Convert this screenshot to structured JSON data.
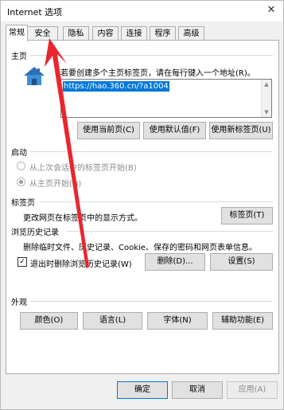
{
  "window": {
    "title": "Internet 选项",
    "close_glyph": "✕"
  },
  "tabs": [
    "常规",
    "安全",
    "隐私",
    "内容",
    "连接",
    "程序",
    "高级"
  ],
  "home": {
    "heading": "主页",
    "description": "若要创建多个主页标签页，请在每行键入一个地址(R)。",
    "url": "https://hao.360.cn/?a1004",
    "buttons": {
      "use_current": "使用当前页(C)",
      "use_default": "使用默认值(F)",
      "use_new_tab": "使用新标签页(U)"
    }
  },
  "startup": {
    "heading": "启动",
    "option_last_session": "从上次会话中的标签页开始(B)",
    "option_home": "从主页开始(H)"
  },
  "tabs_section": {
    "heading": "标签页",
    "description": "更改网页在标签页中的显示方式。",
    "button": "标签页(T)"
  },
  "history": {
    "heading": "浏览历史记录",
    "description": "删除临时文件、历史记录、Cookie、保存的密码和网页表单信息。",
    "checkbox_label": "退出时删除浏览历史记录(W)",
    "checkbox_checked": true,
    "delete_button": "删除(D)...",
    "settings_button": "设置(S)"
  },
  "appearance": {
    "heading": "外观",
    "colors": "颜色(O)",
    "languages": "语言(L)",
    "fonts": "字体(N)",
    "accessibility": "辅助功能(E)"
  },
  "footer": {
    "ok": "确定",
    "cancel": "取消",
    "apply": "应用(A)"
  },
  "colors": {
    "selection": "#0078d7",
    "annotation_arrow": "#e8262e"
  }
}
